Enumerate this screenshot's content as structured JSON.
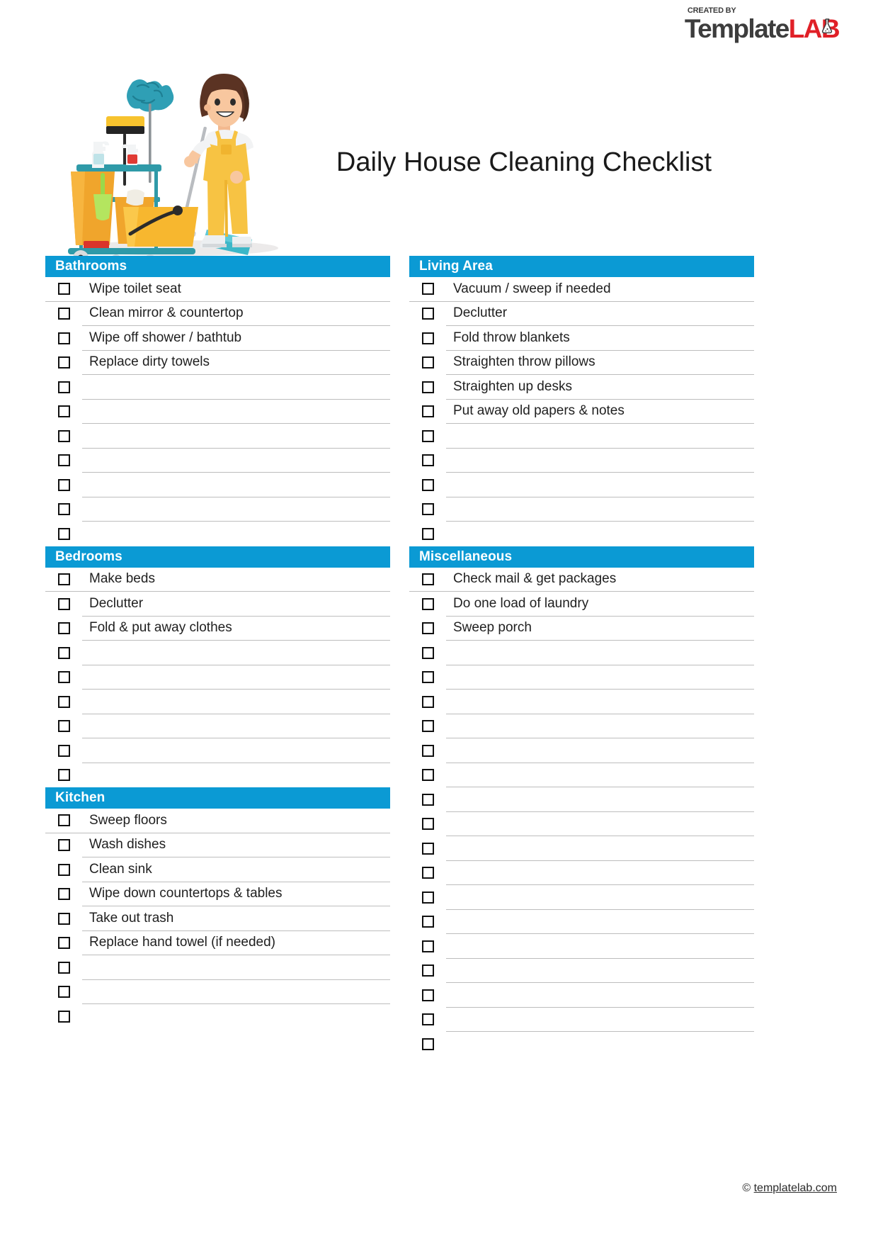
{
  "brand": {
    "created_by": "CREATED BY",
    "name_dark": "Template",
    "name_red": "LAB",
    "flask_icon": "flask-icon",
    "red": "#e02027",
    "dark": "#3d3d3d"
  },
  "title": "Daily House Cleaning Checklist",
  "accent_color": "#0b9ad4",
  "rule_color": "#bdbdbd",
  "illustration": {
    "name": "cleaning-lady-with-janitorial-cart-illustration",
    "alt": "Woman in yellow overalls holding a mop beside a teal cleaning cart with yellow buckets, spray bottles, broom, duster and dustpan"
  },
  "columns": [
    {
      "name": "left-column",
      "sections": [
        {
          "id": "bathrooms",
          "title": "Bathrooms",
          "items": [
            "Wipe toilet seat",
            "Clean mirror & countertop",
            "Wipe off shower / bathtub",
            "Replace dirty towels",
            "",
            "",
            "",
            "",
            "",
            "",
            ""
          ]
        },
        {
          "id": "bedrooms",
          "title": "Bedrooms",
          "items": [
            "Make beds",
            "Declutter",
            "Fold & put away clothes",
            "",
            "",
            "",
            "",
            "",
            ""
          ]
        },
        {
          "id": "kitchen",
          "title": "Kitchen",
          "items": [
            "Sweep floors",
            "Wash dishes",
            "Clean sink",
            "Wipe down countertops & tables",
            "Take out trash",
            "Replace hand towel (if needed)",
            "",
            "",
            ""
          ]
        }
      ]
    },
    {
      "name": "right-column",
      "sections": [
        {
          "id": "living-area",
          "title": "Living Area",
          "items": [
            "Vacuum / sweep if needed",
            "Declutter",
            "Fold throw blankets",
            "Straighten throw pillows",
            "Straighten up desks",
            "Put away old papers & notes",
            "",
            "",
            "",
            "",
            ""
          ]
        },
        {
          "id": "miscellaneous",
          "title": "Miscellaneous",
          "items": [
            "Check mail & get packages",
            "Do one load of laundry",
            "Sweep porch",
            "",
            "",
            "",
            "",
            "",
            "",
            "",
            "",
            "",
            "",
            "",
            "",
            "",
            "",
            "",
            "",
            ""
          ]
        }
      ]
    }
  ],
  "footer": {
    "copyright_symbol": "©",
    "site": "templatelab.com"
  }
}
